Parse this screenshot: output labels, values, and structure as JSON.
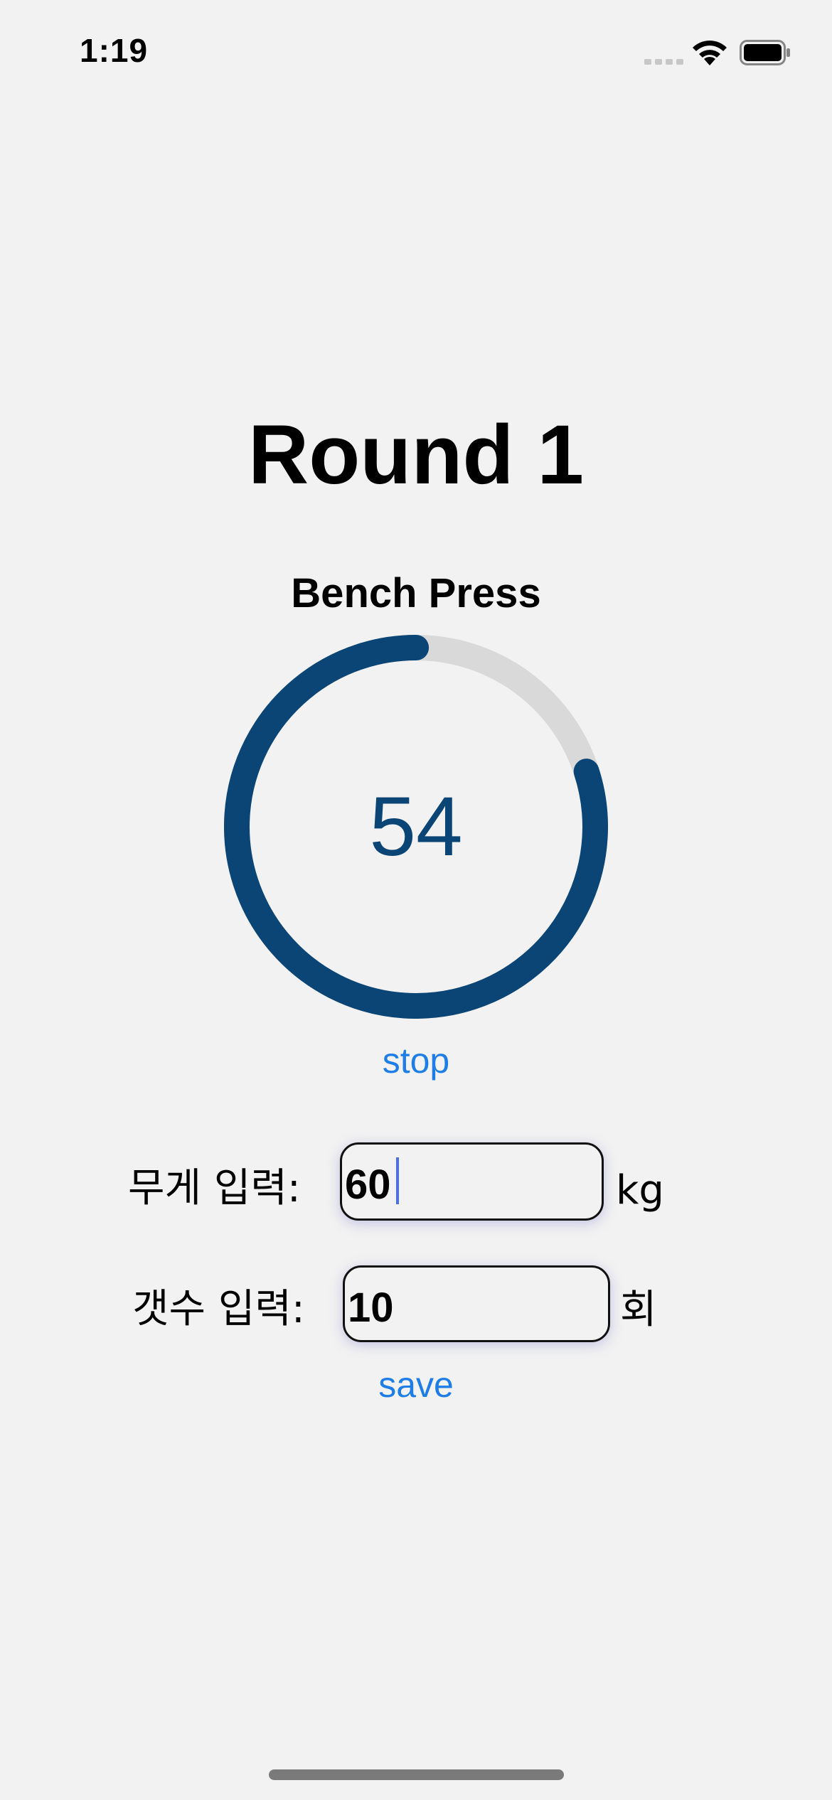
{
  "status_bar": {
    "time": "1:19"
  },
  "workout": {
    "round_title": "Round 1",
    "exercise": "Bench Press",
    "timer_value": "54",
    "timer_progress": 0.8,
    "stop_label": "stop",
    "save_label": "save"
  },
  "weight_field": {
    "label": "무게 입력:",
    "value": "60",
    "unit": "kg"
  },
  "count_field": {
    "label": "갯수 입력:",
    "value": "10",
    "unit": "회"
  },
  "colors": {
    "ring_progress": "#0b4576",
    "ring_track": "#d9d9d9",
    "link": "#1f7de8",
    "background": "#f2f2f2"
  }
}
